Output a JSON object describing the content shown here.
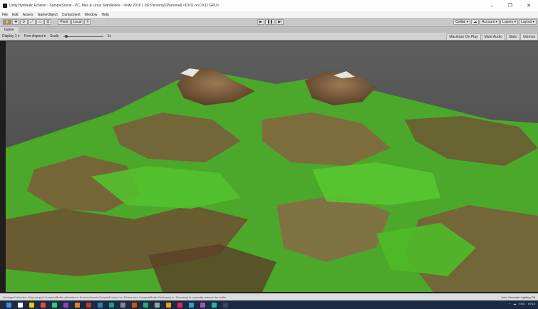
{
  "window": {
    "title": "Unity Hydraulic Erosion - SampleScene - PC, Mac & Linux Standalone - Unity 2018.1.0f2 Personal (Personal) <DX11 on DX11 GPU>",
    "controls": [
      "–",
      "❐",
      "✕"
    ]
  },
  "menu": [
    "File",
    "Edit",
    "Assets",
    "GameObject",
    "Component",
    "Window",
    "Help"
  ],
  "toolbar": {
    "tools": [
      "✋",
      "✥",
      "⟳",
      "⤢",
      "▭",
      "⛭"
    ],
    "pivot": "Pivot",
    "space": "Local",
    "snap": "#",
    "play": [
      "▶",
      "❚❚",
      "▶|"
    ],
    "collab": "Collab ▾",
    "cloud": "☁",
    "account": "Account ▾",
    "layers": "Layers ▾",
    "layout": "Layout ▾"
  },
  "game_tab": {
    "label": "Game"
  },
  "game_bar": {
    "display": "Display 1 ▾",
    "aspect": "Free Aspect ▾",
    "scale_label": "Scale",
    "scale_value": "1x",
    "buttons": [
      "Maximize On Play",
      "Mute Audio",
      "Stats",
      "Gizmos"
    ]
  },
  "status": {
    "message": "GarbageCollection: Disposing of ComputeBuffer allocated in Erosion/Assets/Scripts/Erosion.cs. Please use ComputeBuffer.Release() or .Dispose() to manually release the buffer.",
    "right": "Auto Generate   Lighting Off"
  },
  "taskbar": {
    "icons": [
      "#3b8fe0",
      "#ffffff",
      "#f1c40f",
      "#e74c3c",
      "#2ecc71",
      "#8e44ad",
      "#e67e22",
      "#c0392b",
      "#2980b9",
      "#16a085",
      "#7f8c8d",
      "#d35400",
      "#27ae60",
      "#95a5a6",
      "#f39c12",
      "#e91e63",
      "#3498db",
      "#9b59b6",
      "#1abc9c",
      "#34495e"
    ],
    "tray": [
      "^",
      "☁",
      "ENG",
      "09:16"
    ]
  },
  "colors": {
    "grass": "#4fb82a",
    "rock": "#7a5a3c",
    "sky": "#4c4c4c"
  }
}
